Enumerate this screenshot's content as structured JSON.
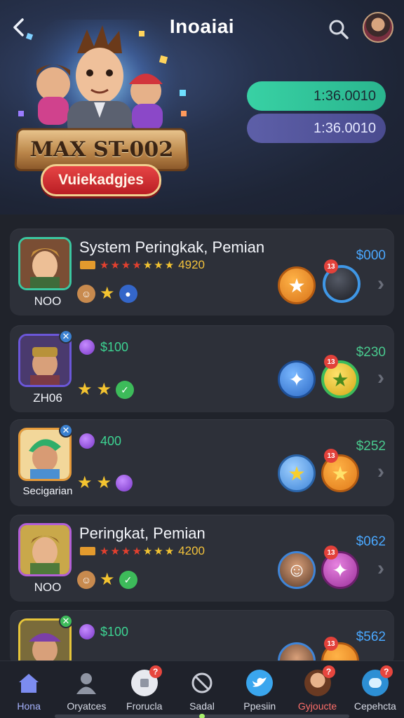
{
  "header": {
    "title": "Inoaiai",
    "back_icon": "chevron-left-icon",
    "search_icon": "search-icon"
  },
  "hero": {
    "banner_text": "MAX ST-002",
    "cta_label": "Vuiekadgjes",
    "stats": [
      {
        "value": "1:36.0010",
        "color": "#38d1a4"
      },
      {
        "value": "1:36.0010",
        "color": "#5d5fa8"
      }
    ]
  },
  "rankings": [
    {
      "code": "NOO",
      "title": "System Peringkak, Pemian",
      "score": "4920",
      "price": "$000",
      "price_color": "#4aa8ff",
      "medal_tag": "13"
    },
    {
      "code": "ZH06",
      "gem_value": "$100",
      "price": "$230",
      "price_color": "#49c98e",
      "medal_tag": "13",
      "badge": "✕"
    },
    {
      "code": "Secigarian",
      "gem_value": "400",
      "price": "$252",
      "price_color": "#49c98e",
      "medal_tag": "13",
      "badge": "✕"
    },
    {
      "code": "NOO",
      "title": "Peringkat, Pemian",
      "score": "4200",
      "price": "$062",
      "price_color": "#4aa8ff",
      "medal_tag": "13"
    },
    {
      "gem_value": "$100",
      "price": "$562",
      "price_color": "#4aa8ff",
      "medal_tag": "13",
      "badge": "✕"
    }
  ],
  "nav": {
    "items": [
      {
        "label": "Hona",
        "icon": "home-icon",
        "active": true
      },
      {
        "label": "Oryatces",
        "icon": "profile-icon"
      },
      {
        "label": "Frorucla",
        "icon": "box-icon",
        "badge": "?"
      },
      {
        "label": "Sadal",
        "icon": "no-sign-icon"
      },
      {
        "label": "Ppesiin",
        "icon": "bird-icon"
      },
      {
        "label": "Gyjoucte",
        "icon": "character-icon",
        "badge": "?"
      },
      {
        "label": "Cepehcta",
        "icon": "chat-icon",
        "badge": "?"
      }
    ]
  }
}
